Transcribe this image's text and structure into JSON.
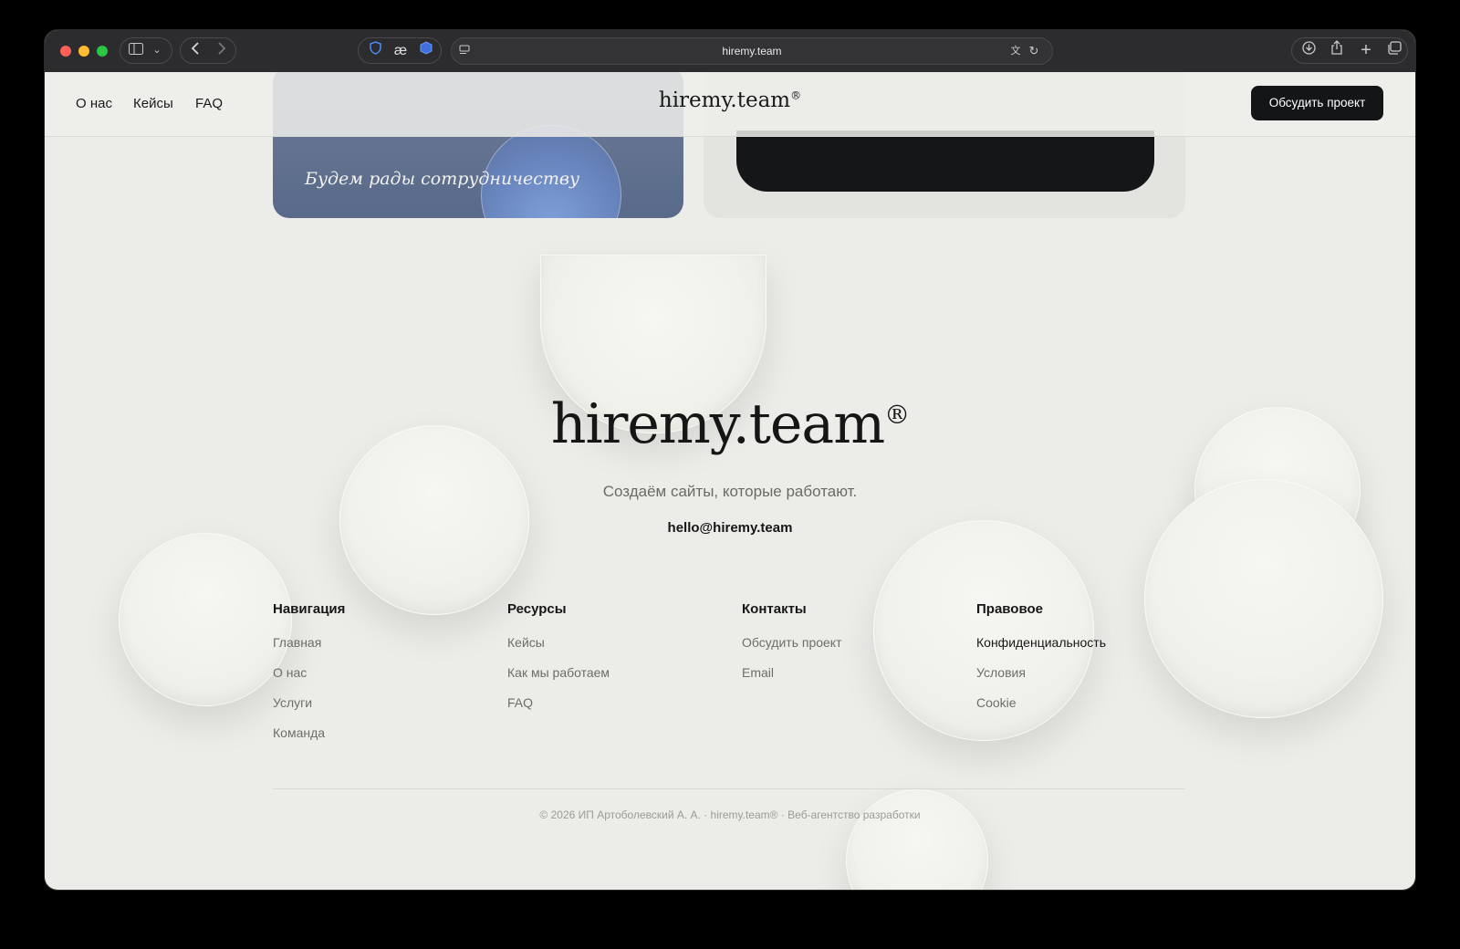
{
  "browser": {
    "url": "hiremy.team"
  },
  "header": {
    "nav": [
      "О нас",
      "Кейсы",
      "FAQ"
    ],
    "logo": "hiremy.team",
    "logo_mark": "®",
    "cta": "Обсудить проект"
  },
  "cards": {
    "blue_text": "Будем рады сотрудничеству"
  },
  "footer": {
    "brand": "hiremy.team",
    "brand_mark": "®",
    "tagline": "Создаём сайты, которые работают.",
    "email": "hello@hiremy.team",
    "columns": [
      {
        "title": "Навигация",
        "items": [
          "Главная",
          "О нас",
          "Услуги",
          "Команда"
        ]
      },
      {
        "title": "Ресурсы",
        "items": [
          "Кейсы",
          "Как мы работаем",
          "FAQ"
        ]
      },
      {
        "title": "Контакты",
        "items": [
          "Обсудить проект",
          "Email"
        ]
      },
      {
        "title": "Правовое",
        "items": [
          "Конфиденциальность",
          "Условия",
          "Cookie"
        ]
      }
    ],
    "copyright": "© 2026 ИП Артоболевский А. А. · hiremy.team® · Веб-агентство разработки"
  },
  "icons": {
    "sidebar": "sidebar-icon",
    "chevron": "chevron-down-icon",
    "back": "back-icon",
    "forward": "forward-icon",
    "download": "download-icon",
    "share": "share-icon",
    "new_tab": "plus-icon",
    "tabs": "tabs-overview-icon"
  },
  "colors": {
    "page_bg": "#ecece8",
    "dark": "#141517",
    "blue_card": "#5d6e8e"
  }
}
